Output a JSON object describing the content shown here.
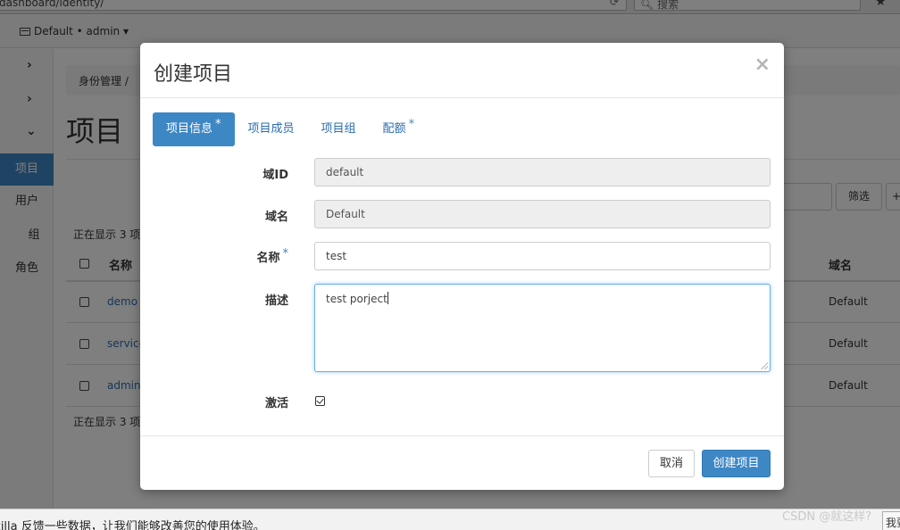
{
  "browser": {
    "url": "dashboard/identity/",
    "search_placeholder": "搜索",
    "reload_icon": "reload-icon",
    "bookmark_icon": "bookmark-star-icon"
  },
  "topnav": {
    "context": "Default • admin ▾"
  },
  "sidebar": {
    "items": [
      {
        "label": "项目",
        "active": true
      },
      {
        "label": "用户"
      },
      {
        "label": "组"
      },
      {
        "label": "角色"
      }
    ]
  },
  "page": {
    "breadcrumb": "身份管理 /",
    "title": "项目",
    "filter_button": "筛选",
    "showing_top": "正在显示 3 项",
    "showing_bottom": "正在显示 3 项",
    "table": {
      "col_name": "名称",
      "col_domain": "域名",
      "rows": [
        {
          "name": "demo",
          "domain": "Default"
        },
        {
          "name": "service",
          "domain": "Default"
        },
        {
          "name": "admin",
          "domain": "Default"
        }
      ]
    }
  },
  "modal": {
    "title": "创建项目",
    "close_glyph": "×",
    "tabs": [
      {
        "label": "项目信息",
        "required": true,
        "active": true
      },
      {
        "label": "项目成员"
      },
      {
        "label": "项目组"
      },
      {
        "label": "配额",
        "required": true
      }
    ],
    "fields": {
      "domain_id": {
        "label": "域ID",
        "value": "default"
      },
      "domain_name": {
        "label": "域名",
        "value": "Default"
      },
      "name": {
        "label": "名称",
        "value": "test",
        "required": true
      },
      "description": {
        "label": "描述",
        "value": "test porject"
      },
      "enabled": {
        "label": "激活",
        "checked": true
      }
    },
    "required_marker": "*",
    "cancel_button": "取消",
    "submit_button": "创建项目"
  },
  "statusbar": {
    "message": "zilla 反馈一些数据，让我们能够改善您的使用体验。",
    "right_button": "我要"
  },
  "watermark": "CSDN @就这样?"
}
